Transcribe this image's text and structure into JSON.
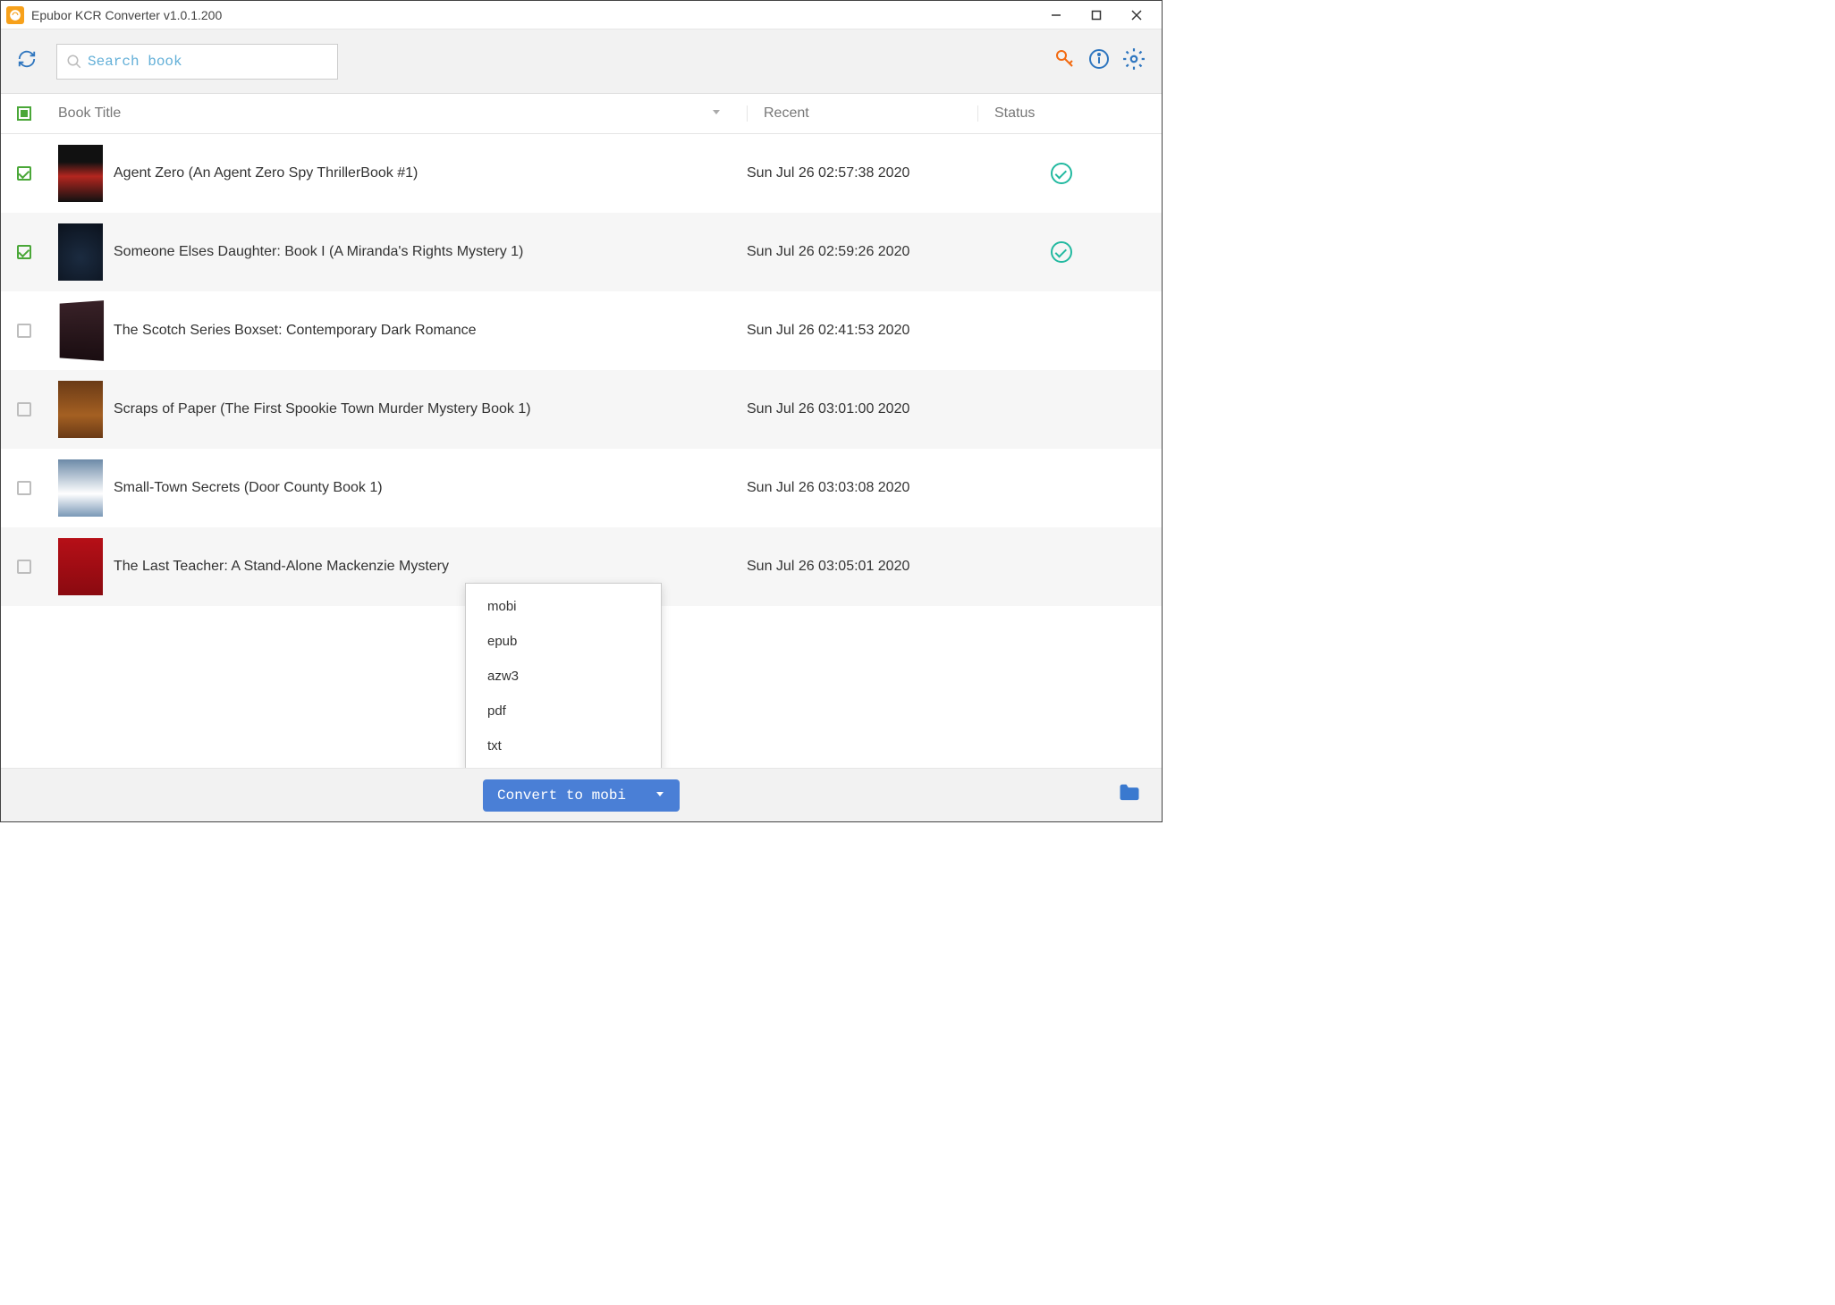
{
  "window": {
    "title": "Epubor KCR Converter v1.0.1.200"
  },
  "toolbar": {
    "search_placeholder": "Search book"
  },
  "columns": {
    "title": "Book Title",
    "recent": "Recent",
    "status": "Status"
  },
  "books": [
    {
      "title": "Agent Zero (An Agent Zero Spy ThrillerBook #1)",
      "recent": "Sun Jul 26 02:57:38 2020",
      "checked": true,
      "status_ok": true,
      "cover_class": "cover1"
    },
    {
      "title": "Someone Elses Daughter: Book I (A Miranda's Rights Mystery 1)",
      "recent": "Sun Jul 26 02:59:26 2020",
      "checked": true,
      "status_ok": true,
      "cover_class": "cover2"
    },
    {
      "title": "The Scotch Series Boxset: Contemporary Dark Romance",
      "recent": "Sun Jul 26 02:41:53 2020",
      "checked": false,
      "status_ok": false,
      "cover_class": "cover3"
    },
    {
      "title": "Scraps of Paper (The First Spookie Town Murder Mystery Book 1)",
      "recent": "Sun Jul 26 03:01:00 2020",
      "checked": false,
      "status_ok": false,
      "cover_class": "cover4"
    },
    {
      "title": "Small-Town Secrets (Door County Book 1)",
      "recent": "Sun Jul 26 03:03:08 2020",
      "checked": false,
      "status_ok": false,
      "cover_class": "cover5"
    },
    {
      "title": "The Last Teacher: A Stand-Alone Mackenzie Mystery",
      "recent": "Sun Jul 26 03:05:01 2020",
      "checked": false,
      "status_ok": false,
      "cover_class": "cover6"
    }
  ],
  "format_menu": {
    "items": [
      "mobi",
      "epub",
      "azw3",
      "pdf",
      "txt"
    ]
  },
  "bottom": {
    "convert_label": "Convert to mobi"
  }
}
